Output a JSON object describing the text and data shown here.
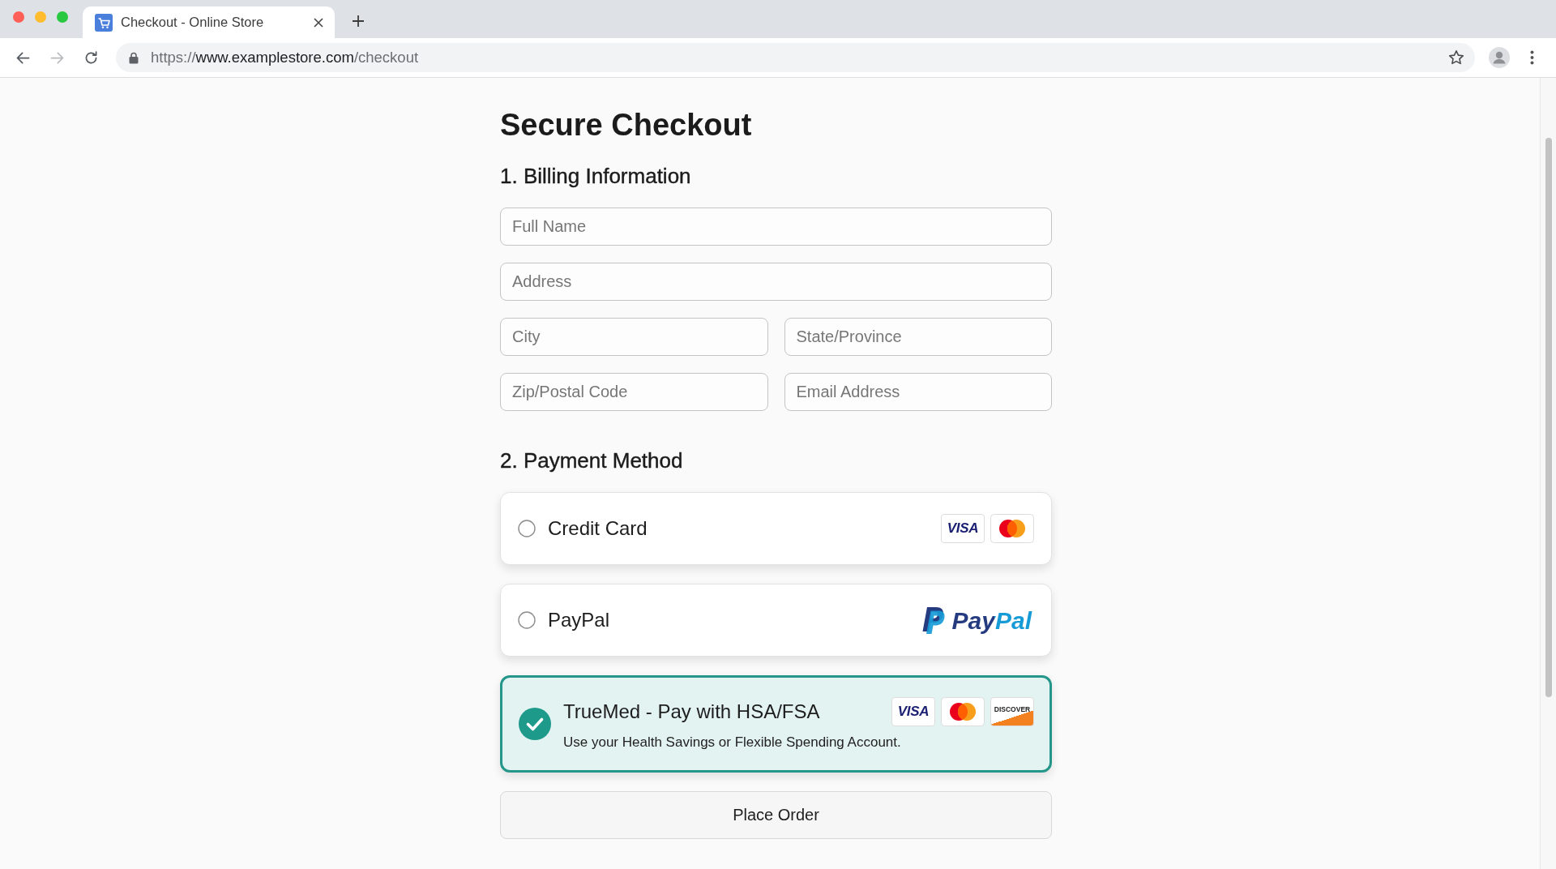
{
  "browser": {
    "tabs": [
      {
        "title": "Checkout - Online Store",
        "selected": true
      }
    ],
    "nav_buttons": [
      {
        "kind": "back",
        "disabled": false
      },
      {
        "kind": "forward",
        "disabled": true
      },
      {
        "kind": "reload",
        "disabled": false
      }
    ],
    "address_bar": {
      "scheme": "https://",
      "host": "www.examplestore.com",
      "path": "/checkout"
    }
  },
  "page": {
    "title": "Secure Checkout",
    "billing": {
      "heading": "1. Billing Information",
      "rows": [
        {
          "fields": [
            {
              "placeholder": "Full Name"
            }
          ]
        },
        {
          "fields": [
            {
              "placeholder": "Address"
            }
          ]
        },
        {
          "fields": [
            {
              "placeholder": "City"
            },
            {
              "placeholder": "State/Province"
            }
          ]
        },
        {
          "fields": [
            {
              "placeholder": "Zip/Postal Code"
            },
            {
              "placeholder": "Email Address"
            }
          ]
        }
      ]
    },
    "payment": {
      "heading": "2. Payment Method",
      "methods": [
        {
          "label": "Credit Card",
          "selected": false,
          "logos": [
            {
              "kind": "visa",
              "text": "VISA"
            },
            {
              "kind": "mastercard"
            }
          ]
        },
        {
          "label": "PayPal",
          "selected": false,
          "logos": [
            {
              "kind": "paypal",
              "text": "PayPal"
            }
          ]
        },
        {
          "label": "TrueMed - Pay with HSA/FSA",
          "description": "Use your Health Savings or Flexible Spending Account.",
          "selected": true,
          "logos": [
            {
              "kind": "visa",
              "text": "VISA"
            },
            {
              "kind": "mastercard"
            },
            {
              "kind": "discover",
              "text": "DISCOVER"
            }
          ]
        }
      ]
    },
    "submit_button": "Place Order"
  }
}
